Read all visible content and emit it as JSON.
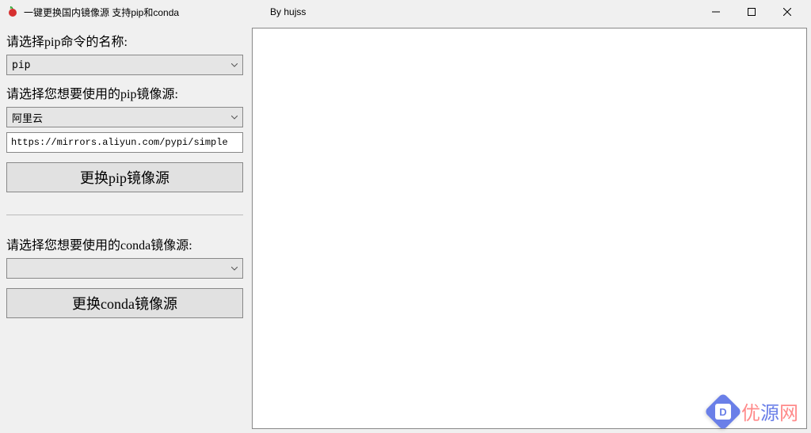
{
  "window": {
    "title": "一键更换国内镜像源  支持pip和conda",
    "author": "By hujss"
  },
  "left": {
    "pip_cmd_label": "请选择pip命令的名称:",
    "pip_cmd_value": "pip",
    "pip_mirror_label": "请选择您想要使用的pip镜像源:",
    "pip_mirror_value": "阿里云",
    "pip_url": "https://mirrors.aliyun.com/pypi/simple",
    "pip_button": "更换pip镜像源",
    "conda_mirror_label": "请选择您想要使用的conda镜像源:",
    "conda_mirror_value": "",
    "conda_button": "更换conda镜像源"
  },
  "watermark": {
    "logo_letter": "D",
    "t1": "优",
    "t2": "源",
    "t3": "网"
  }
}
